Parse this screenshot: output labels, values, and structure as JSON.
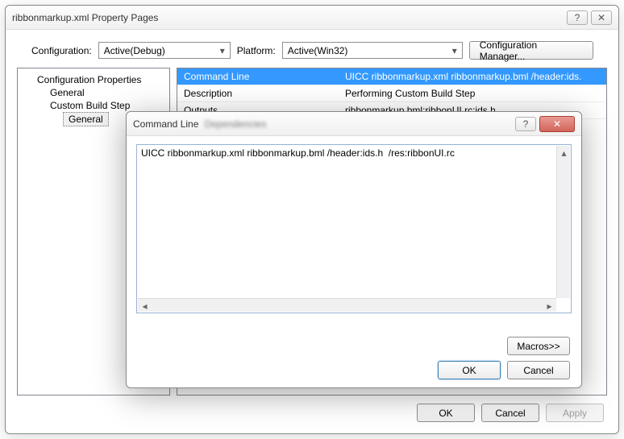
{
  "main_window": {
    "title": "ribbonmarkup.xml Property Pages",
    "help_label": "?",
    "close_label": "✕"
  },
  "config": {
    "configuration_label": "Configuration:",
    "configuration_value": "Active(Debug)",
    "platform_label": "Platform:",
    "platform_value": "Active(Win32)",
    "config_manager_label": "Configuration Manager..."
  },
  "tree": {
    "root": "Configuration Properties",
    "general": "General",
    "custom_build_step": "Custom Build Step",
    "general2": "General"
  },
  "grid": {
    "rows": [
      {
        "label": "Command Line",
        "value": "UICC ribbonmarkup.xml ribbonmarkup.bml /header:ids."
      },
      {
        "label": "Description",
        "value": "Performing Custom Build Step"
      },
      {
        "label": "Outputs",
        "value": "ribbonmarkup.bml;ribbonUI.rc;ids.h"
      }
    ]
  },
  "footer": {
    "ok": "OK",
    "cancel": "Cancel",
    "apply": "Apply"
  },
  "cmd_window": {
    "title": "Command Line",
    "blur_text": "Dependencies",
    "help_label": "?",
    "close_label": "✕",
    "value": "UICC ribbonmarkup.xml ribbonmarkup.bml /header:ids.h  /res:ribbonUI.rc",
    "macros": "Macros>>",
    "ok": "OK",
    "cancel": "Cancel"
  }
}
